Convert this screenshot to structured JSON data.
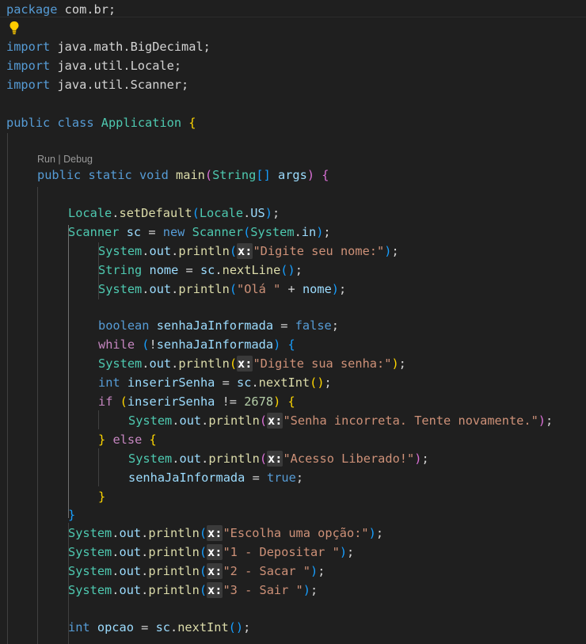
{
  "editor": {
    "codelens": {
      "run": "Run",
      "sep": " | ",
      "debug": "Debug"
    },
    "inlay_hint": "x:",
    "lines": {
      "l1": {
        "kw": "package",
        "rest": " com.br;"
      },
      "l3": {
        "kw": "import",
        "rest": " java.math.BigDecimal;"
      },
      "l4": {
        "kw": "import",
        "rest": " java.util.Locale;"
      },
      "l5": {
        "kw": "import",
        "rest": " java.util.Scanner;"
      },
      "l7": {
        "kw1": "public",
        "kw2": "class",
        "name": "Application",
        "brace": "{"
      },
      "l9": {
        "kw1": "public",
        "kw2": "static",
        "kw3": "void",
        "fn": "main",
        "type": "String",
        "arr": "[]",
        "param": "args"
      },
      "l11": {
        "obj": "Locale",
        "fn": "setDefault",
        "arg_obj": "Locale",
        "arg_field": "US"
      },
      "l12": {
        "type": "Scanner",
        "var": "sc",
        "kw": "new",
        "ctor": "Scanner",
        "arg_obj": "System",
        "arg_field": "in"
      },
      "l13": {
        "obj": "System",
        "field": "out",
        "fn": "println",
        "str": "\"Digite seu nome:\""
      },
      "l14": {
        "type": "String",
        "var": "nome",
        "obj": "sc",
        "fn": "nextLine"
      },
      "l15": {
        "obj": "System",
        "field": "out",
        "fn": "println",
        "str": "\"Olá \"",
        "op": " + ",
        "var": "nome"
      },
      "l17": {
        "type": "boolean",
        "var": "senhaJaInformada",
        "val": "false"
      },
      "l18": {
        "kw": "while",
        "var": "senhaJaInformada"
      },
      "l19": {
        "obj": "System",
        "field": "out",
        "fn": "println",
        "str": "\"Digite sua senha:\""
      },
      "l20": {
        "type": "int",
        "var": "inserirSenha",
        "obj": "sc",
        "fn": "nextInt"
      },
      "l21": {
        "kw": "if",
        "var": "inserirSenha",
        "num": "2678"
      },
      "l22": {
        "obj": "System",
        "field": "out",
        "fn": "println",
        "str": "\"Senha incorreta. Tente novamente.\""
      },
      "l23": {
        "kw": "else"
      },
      "l24": {
        "obj": "System",
        "field": "out",
        "fn": "println",
        "str": "\"Acesso Liberado!\""
      },
      "l25": {
        "var": "senhaJaInformada",
        "val": "true"
      },
      "l28": {
        "obj": "System",
        "field": "out",
        "fn": "println",
        "str": "\"Escolha uma opção:\""
      },
      "l29": {
        "obj": "System",
        "field": "out",
        "fn": "println",
        "str": "\"1 - Depositar \""
      },
      "l30": {
        "obj": "System",
        "field": "out",
        "fn": "println",
        "str": "\"2 - Sacar \""
      },
      "l31": {
        "obj": "System",
        "field": "out",
        "fn": "println",
        "str": "\"3 - Sair \""
      },
      "l33": {
        "type": "int",
        "var": "opcao",
        "obj": "sc",
        "fn": "nextInt"
      }
    }
  },
  "colors": {
    "background": "#1f1f1f",
    "keyword": "#569cd6",
    "control": "#c586c0",
    "type": "#4ec9b0",
    "variable": "#9cdcfe",
    "function": "#dcdcaa",
    "string": "#ce9178",
    "number": "#b5cea8",
    "bracket_1": "#ffd700",
    "bracket_2": "#da70d6",
    "bracket_3": "#179fff"
  },
  "icons": {
    "lightbulb": "lightbulb-icon"
  }
}
